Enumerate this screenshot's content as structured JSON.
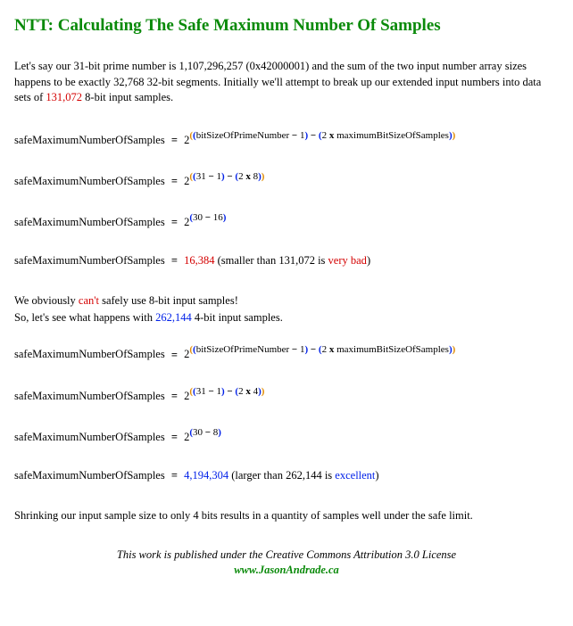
{
  "title": "NTT: Calculating The Safe Maximum Number Of Samples",
  "intro": {
    "t1": "Let's say our 31-bit prime number is 1,107,296,257 (0x42000001) and the sum of the two input number array sizes happens to be exactly 32,768 32-bit segments.  Initially we'll attempt to break up our extended input numbers into data sets of ",
    "hl1": "131,072",
    "t2": " 8-bit input samples."
  },
  "lhs": "safeMaximumNumberOfSamples",
  "eq": "=",
  "base": "2",
  "sym": {
    "p_outer_open": "(",
    "p_outer_close": ")",
    "p_open": "(",
    "p_close": ")",
    "minus": " − ",
    "times": "x",
    "sp": "  "
  },
  "f1": {
    "a": "bitSizeOfPrimeNumber",
    "b": "1",
    "c": "2",
    "d": "maximumBitSizeOfSamples"
  },
  "s1": {
    "a": "31",
    "b": "1",
    "c": "2",
    "d": "8"
  },
  "s2": {
    "a": "30",
    "b": "16"
  },
  "r1": {
    "value": "16,384",
    "note1": "  (smaller than 131,072 is ",
    "bad": "very bad",
    "note2": ")"
  },
  "mid": {
    "t1": "We obviously ",
    "cant": "can't",
    "t2": " safely use 8-bit input samples!",
    "t3": "So, let's see what happens with ",
    "hl2": "262,144",
    "t4": " 4-bit input samples."
  },
  "s3": {
    "a": "31",
    "b": "1",
    "c": "2",
    "d": "4"
  },
  "s4": {
    "a": "30",
    "b": "8"
  },
  "r2": {
    "value": "4,194,304",
    "note1": "  (larger than 262,144 is ",
    "good": "excellent",
    "note2": ")"
  },
  "concl": "Shrinking our input sample size to only 4 bits results in a quantity of samples well under the safe limit.",
  "footer": {
    "license": "This work is published under the Creative Commons Attribution 3.0 License",
    "url": "www.JasonAndrade.ca"
  }
}
